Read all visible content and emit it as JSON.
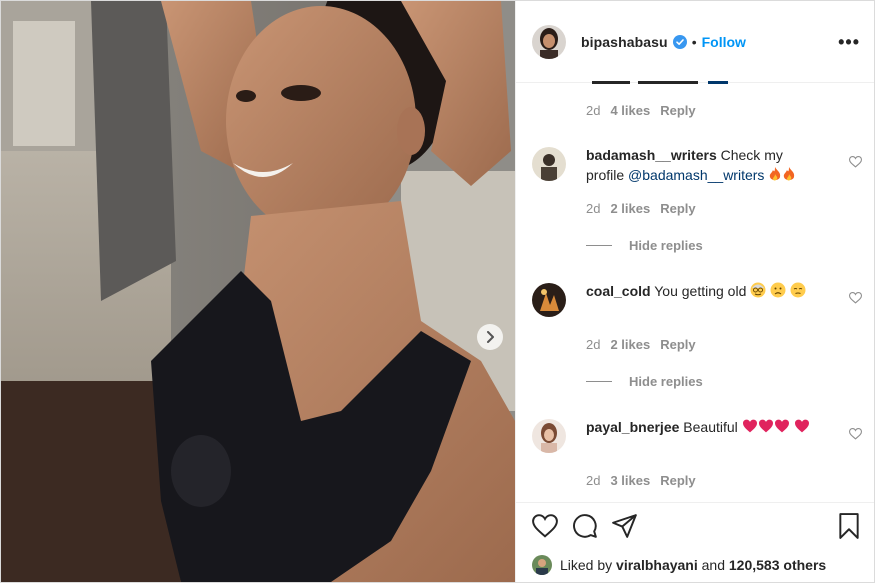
{
  "post": {
    "author": "bipashabasu",
    "follow_label": "Follow",
    "separator": "•",
    "more_label": "•••",
    "top_meta": {
      "time": "2d",
      "likes": "4 likes",
      "reply": "Reply"
    }
  },
  "comments": [
    {
      "user": "badamash__writers",
      "text": "Check my profile",
      "mention": "@badamash__writers",
      "emojis": [
        "fire",
        "fire"
      ],
      "time": "2d",
      "likes": "2 likes",
      "reply": "Reply",
      "hide_replies": "Hide replies"
    },
    {
      "user": "coal_cold",
      "text": "You getting old",
      "emojis": [
        "older-face",
        "sad-face",
        "neutral-face"
      ],
      "time": "2d",
      "likes": "2 likes",
      "reply": "Reply",
      "hide_replies": "Hide replies"
    },
    {
      "user": "payal_bnerjee",
      "text": "Beautiful",
      "emojis": [
        "heart",
        "heart",
        "heart",
        "heart"
      ],
      "time": "2d",
      "likes": "3 likes",
      "reply": "Reply"
    }
  ],
  "likes_summary": {
    "prefix": "Liked by",
    "user": "viralbhayani",
    "joiner": "and",
    "count": "120,583 others"
  },
  "colors": {
    "link_blue": "#0095f6",
    "mention_blue": "#00376b",
    "muted": "#8e8e8e",
    "text": "#262626"
  }
}
